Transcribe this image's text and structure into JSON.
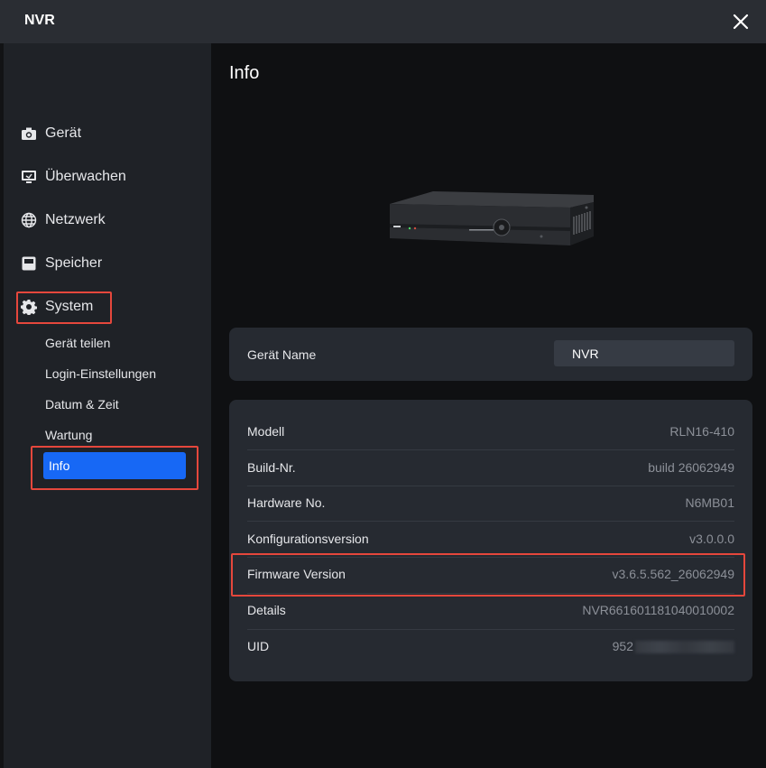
{
  "window": {
    "title": "NVR",
    "close_icon": "close-icon"
  },
  "sidebar": {
    "items": [
      {
        "label": "Gerät",
        "icon": "camera-icon"
      },
      {
        "label": "Überwachen",
        "icon": "monitor-icon"
      },
      {
        "label": "Netzwerk",
        "icon": "globe-icon"
      },
      {
        "label": "Speicher",
        "icon": "storage-icon"
      },
      {
        "label": "System",
        "icon": "gear-icon"
      }
    ],
    "sub_items": [
      "Gerät teilen",
      "Login-Einstellungen",
      "Datum & Zeit",
      "Wartung",
      "Info"
    ]
  },
  "main": {
    "title": "Info",
    "device_name_label": "Gerät Name",
    "device_name_value": "NVR",
    "rows": [
      {
        "label": "Modell",
        "value": "RLN16-410"
      },
      {
        "label": "Build-Nr.",
        "value": "build 26062949"
      },
      {
        "label": "Hardware No.",
        "value": "N6MB01"
      },
      {
        "label": "Konfigurationsversion",
        "value": "v3.0.0.0"
      },
      {
        "label": "Firmware Version",
        "value": "v3.6.5.562_26062949"
      },
      {
        "label": "Details",
        "value": "NVR661601181040010002"
      },
      {
        "label": "UID",
        "value": "952"
      }
    ]
  },
  "colors": {
    "accent": "#1768f5",
    "highlight": "#e5473c",
    "panel": "#262a31",
    "sidebar": "#1f2227"
  }
}
